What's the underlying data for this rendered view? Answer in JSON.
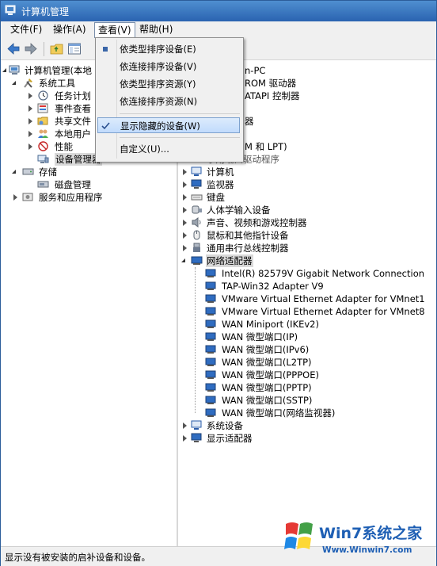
{
  "window": {
    "title": "计算机管理"
  },
  "menubar": [
    {
      "label": "文件(F)"
    },
    {
      "label": "操作(A)"
    },
    {
      "label": "查看(V)"
    },
    {
      "label": "帮助(H)"
    }
  ],
  "view_menu": {
    "items": [
      {
        "label": "依类型排序设备(E)"
      },
      {
        "label": "依连接排序设备(V)"
      },
      {
        "label": "依类型排序资源(Y)"
      },
      {
        "label": "依连接排序资源(N)"
      },
      {
        "label": "显示隐藏的设备(W)"
      },
      {
        "label": "自定义(U)..."
      }
    ]
  },
  "left_tree": [
    {
      "label": "计算机管理(本地"
    },
    {
      "label": "系统工具"
    },
    {
      "label": "任务计划"
    },
    {
      "label": "事件查看"
    },
    {
      "label": "共享文件"
    },
    {
      "label": "本地用户"
    },
    {
      "label": "性能"
    },
    {
      "label": "设备管理器"
    },
    {
      "label": "存储"
    },
    {
      "label": "磁盘管理"
    },
    {
      "label": "服务和应用程序"
    }
  ],
  "right_tree": {
    "partial": [
      {
        "label": "n-PC"
      },
      {
        "label": "ROM 驱动器"
      },
      {
        "label": "ATAPI 控制器"
      },
      {
        "label": "器"
      },
      {
        "label": "M 和 LPT)"
      },
      {
        "label": "事用端口驱动程序"
      }
    ],
    "categories": [
      {
        "label": "计算机"
      },
      {
        "label": "监视器"
      },
      {
        "label": "键盘"
      },
      {
        "label": "人体学输入设备"
      },
      {
        "label": "声音、视频和游戏控制器"
      },
      {
        "label": "鼠标和其他指针设备"
      },
      {
        "label": "通用串行总线控制器"
      },
      {
        "label": "网络适配器"
      }
    ],
    "adapters": [
      {
        "label": "Intel(R) 82579V Gigabit Network Connection"
      },
      {
        "label": "TAP-Win32 Adapter V9"
      },
      {
        "label": "VMware Virtual Ethernet Adapter for VMnet1"
      },
      {
        "label": "VMware Virtual Ethernet Adapter for VMnet8"
      },
      {
        "label": "WAN Miniport (IKEv2)"
      },
      {
        "label": "WAN 微型端口(IP)"
      },
      {
        "label": "WAN 微型端口(IPv6)"
      },
      {
        "label": "WAN 微型端口(L2TP)"
      },
      {
        "label": "WAN 微型端口(PPPOE)"
      },
      {
        "label": "WAN 微型端口(PPTP)"
      },
      {
        "label": "WAN 微型端口(SSTP)"
      },
      {
        "label": "WAN 微型端口(网络监视器)"
      }
    ],
    "after": [
      {
        "label": "系统设备"
      },
      {
        "label": "显示适配器"
      }
    ]
  },
  "statusbar": {
    "text": "显示没有被安装的启补设备和设备。"
  },
  "watermark": {
    "brand": "Win7系统之家",
    "url": "Www.Winwin7.com"
  },
  "colors": {
    "title_blue": "#2a63b0",
    "selection_blue": "#c1dbfc",
    "icon_blue": "#2a5ca8"
  }
}
